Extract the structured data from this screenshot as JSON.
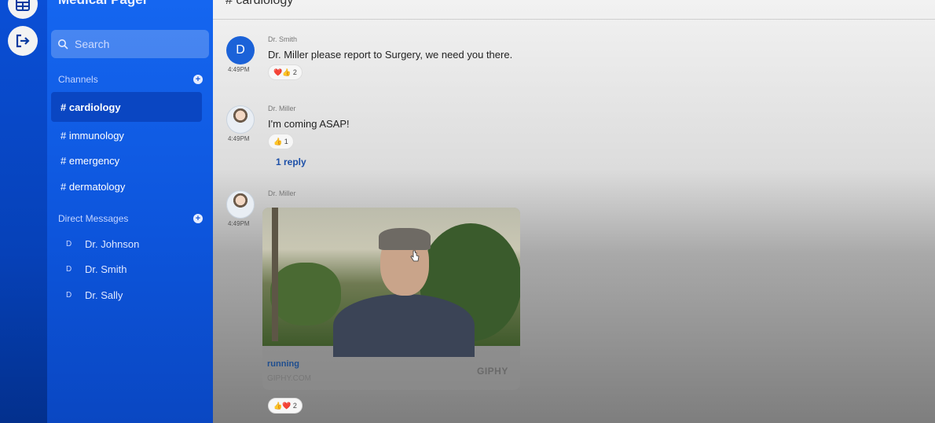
{
  "app": {
    "title": "Medical Pager"
  },
  "search": {
    "placeholder": "Search"
  },
  "sidebar": {
    "channels_label": "Channels",
    "channels": [
      "# cardiology",
      "# immunology",
      "# emergency",
      "# dermatology"
    ],
    "dm_label": "Direct Messages",
    "direct_messages": [
      {
        "initial": "D",
        "name": "Dr. Johnson"
      },
      {
        "initial": "D",
        "name": "Dr. Smith"
      },
      {
        "initial": "D",
        "name": "Dr. Sally"
      }
    ]
  },
  "main": {
    "channel_title": "# cardiology",
    "messages": [
      {
        "author": "Dr. Smith",
        "avatar_initial": "D",
        "time": "4:49PM",
        "text": "Dr. Miller please report to Surgery, we need you there.",
        "reactions": "❤️👍 2"
      },
      {
        "author": "Dr. Miller",
        "time": "4:49PM",
        "text": "I'm coming ASAP!",
        "reactions": "👍 1",
        "reply": "1 reply"
      },
      {
        "author": "Dr. Miller",
        "time": "4:49PM",
        "gif": {
          "caption": "running",
          "domain": "GIPHY.COM",
          "brand": "GIPHY"
        },
        "reactions": "👍❤️ 2"
      }
    ]
  },
  "colors": {
    "accent": "#1566f0",
    "rail": "#0a4fd6",
    "link": "#1c4fa8"
  },
  "icons": [
    "apps-grid-icon",
    "logout-icon",
    "search-icon",
    "plus-icon",
    "cursor-hand-icon"
  ]
}
